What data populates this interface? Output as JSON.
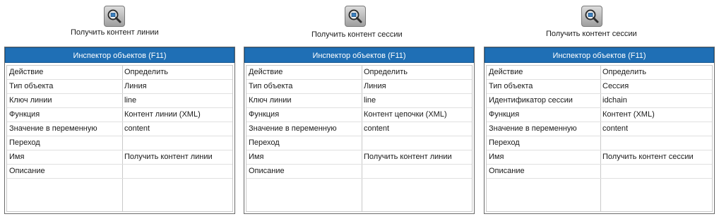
{
  "blocks": [
    {
      "caption": "Получить контент линии",
      "inspector": {
        "title": "Инспектор объектов (F11)",
        "rows": [
          {
            "key": "Действие",
            "value": "Определить"
          },
          {
            "key": "Тип объекта",
            "value": "Линия"
          },
          {
            "key": "Ключ линии",
            "value": "line"
          },
          {
            "key": "Функция",
            "value": "Контент линии (XML)"
          },
          {
            "key": "Значение в переменную",
            "value": "content"
          },
          {
            "key": "Переход",
            "value": ""
          },
          {
            "key": "Имя",
            "value": "Получить контент линии"
          },
          {
            "key": "Описание",
            "value": ""
          }
        ]
      }
    },
    {
      "caption": "Получить контент сессии",
      "inspector": {
        "title": "Инспектор объектов (F11)",
        "rows": [
          {
            "key": "Действие",
            "value": "Определить"
          },
          {
            "key": "Тип объекта",
            "value": "Линия"
          },
          {
            "key": "Ключ линии",
            "value": "line"
          },
          {
            "key": "Функция",
            "value": "Контент цепочки (XML)"
          },
          {
            "key": "Значение в переменную",
            "value": "content"
          },
          {
            "key": "Переход",
            "value": ""
          },
          {
            "key": "Имя",
            "value": "Получить контент линии"
          },
          {
            "key": "Описание",
            "value": ""
          }
        ]
      }
    },
    {
      "caption": "Получить контент сессии",
      "inspector": {
        "title": "Инспектор объектов (F11)",
        "rows": [
          {
            "key": "Действие",
            "value": "Определить"
          },
          {
            "key": "Тип объекта",
            "value": "Сессия"
          },
          {
            "key": "Идентификатор сессии",
            "value": "idchain"
          },
          {
            "key": "Функция",
            "value": "Контент (XML)"
          },
          {
            "key": "Значение в переменную",
            "value": "content"
          },
          {
            "key": "Переход",
            "value": ""
          },
          {
            "key": "Имя",
            "value": "Получить контент сессии"
          },
          {
            "key": "Описание",
            "value": ""
          }
        ]
      }
    }
  ],
  "icons": {
    "node_icon": "search-content-icon"
  },
  "colors": {
    "title_bar": "#1f6fb5",
    "border": "#6b6b6b",
    "grid": "#c9c9c9"
  }
}
